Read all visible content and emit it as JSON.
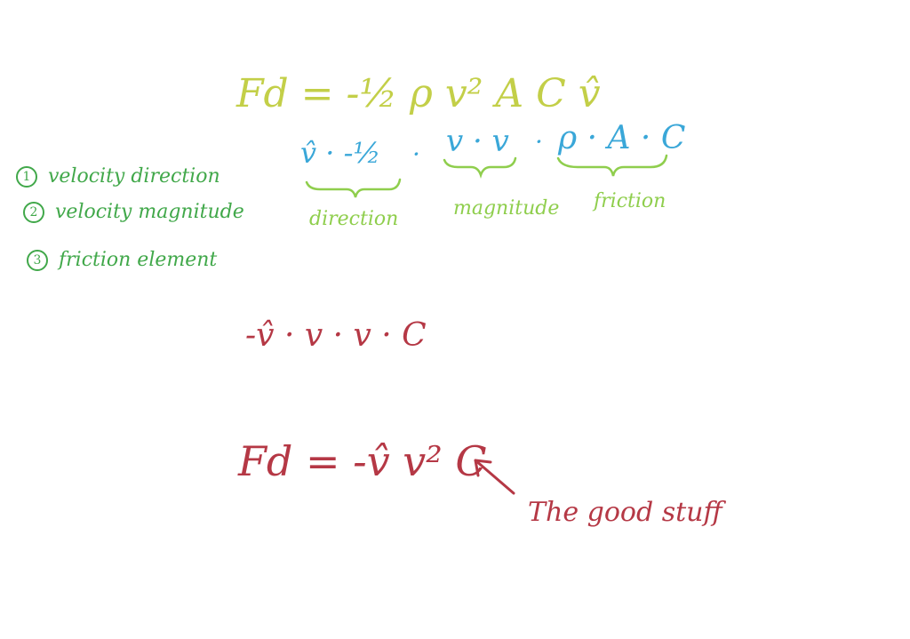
{
  "colors": {
    "yellow": "#c3cf48",
    "blue": "#3aa7d8",
    "green_light": "#8fce4d",
    "green_dark": "#41a84a",
    "red": "#b53845"
  },
  "formula_top": "Fd = -½ ρ v² A C v̂",
  "factored": {
    "direction_terms": "v̂ · -½",
    "magnitude_terms": "v · v",
    "friction_terms": "ρ · A · C",
    "dot": "·"
  },
  "labels": {
    "direction": "direction",
    "magnitude": "magnitude",
    "friction": "friction"
  },
  "list": {
    "item1_num": "1",
    "item1": "velocity direction",
    "item2_num": "2",
    "item2": "velocity magnitude",
    "item3_num": "3",
    "item3": "friction element"
  },
  "simplified": "-v̂ · v · v · C",
  "final_formula": "Fd = -v̂ v² C",
  "annotation": "The good stuff"
}
